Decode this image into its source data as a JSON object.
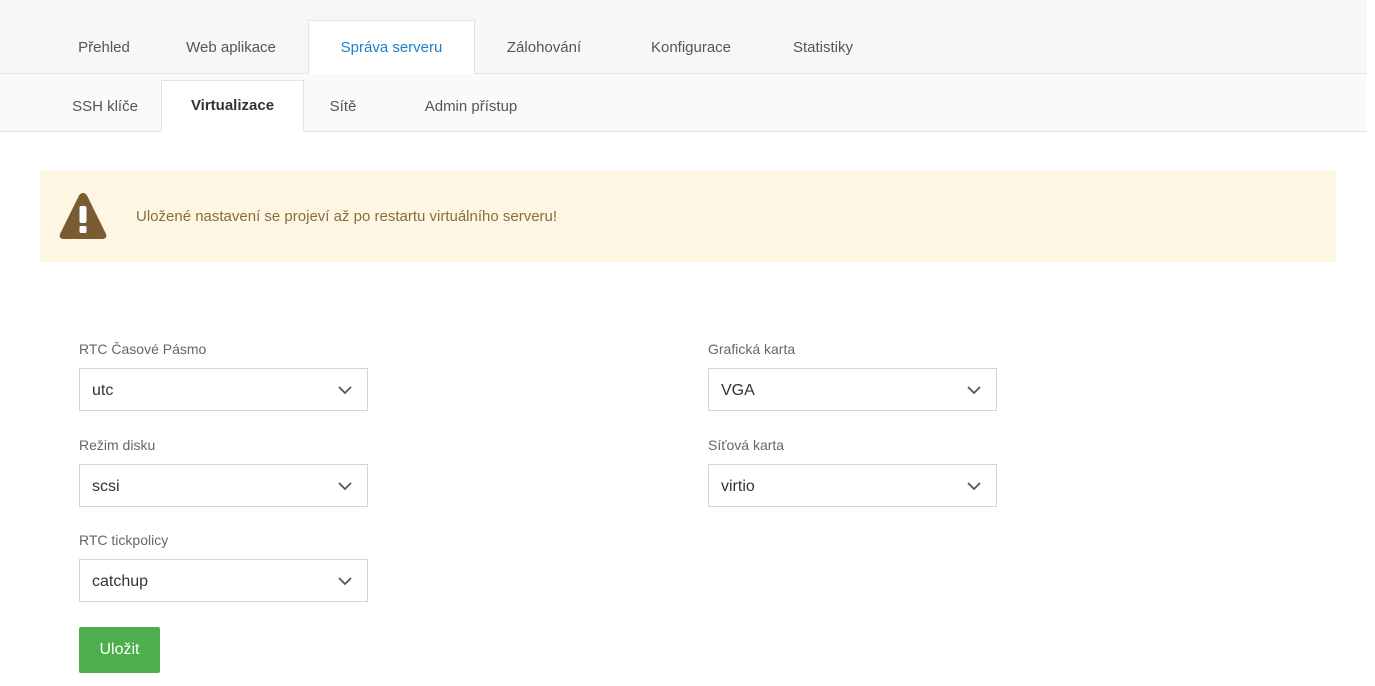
{
  "top_tabs": [
    {
      "label": "Přehled"
    },
    {
      "label": "Web aplikace"
    },
    {
      "label": "Správa serveru",
      "active": true
    },
    {
      "label": "Zálohování"
    },
    {
      "label": "Konfigurace"
    },
    {
      "label": "Statistiky"
    }
  ],
  "sub_tabs": [
    {
      "label": "SSH klíče"
    },
    {
      "label": "Virtualizace",
      "active": true
    },
    {
      "label": "Sítě"
    },
    {
      "label": "Admin přístup"
    }
  ],
  "alert": {
    "icon": "warning-triangle-icon",
    "text": "Uložené nastavení se projeví až po restartu virtuálního serveru!"
  },
  "form": {
    "rtc_timezone": {
      "label": "RTC Časové Pásmo",
      "value": "utc"
    },
    "disk_mode": {
      "label": "Režim disku",
      "value": "scsi"
    },
    "rtc_tickpolicy": {
      "label": "RTC tickpolicy",
      "value": "catchup"
    },
    "graphics_card": {
      "label": "Grafická karta",
      "value": "VGA"
    },
    "network_card": {
      "label": "Síťová karta",
      "value": "virtio"
    },
    "save_label": "Uložit"
  },
  "colors": {
    "active_tab_text": "#1e7fc8",
    "alert_bg": "#fdf6e2",
    "alert_text": "#8a6d3b",
    "warning_icon": "#7a5c33",
    "save_button": "#4cae4c"
  }
}
